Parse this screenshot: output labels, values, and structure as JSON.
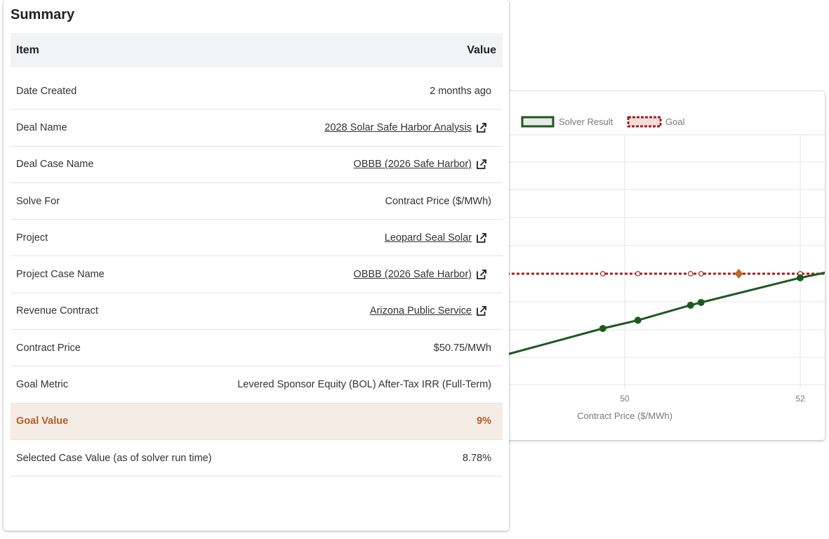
{
  "summary": {
    "title": "Summary",
    "header": {
      "item": "Item",
      "value": "Value"
    },
    "rows": [
      {
        "label": "Date Created",
        "value": "2 months ago",
        "link": false
      },
      {
        "label": "Deal Name",
        "value": "2028 Solar Safe Harbor Analysis",
        "link": true
      },
      {
        "label": "Deal Case Name",
        "value": "OBBB (2026 Safe Harbor)",
        "link": true
      },
      {
        "label": "Solve For",
        "value": "Contract Price ($/MWh)",
        "link": false
      },
      {
        "label": "Project",
        "value": "Leopard Seal Solar",
        "link": true
      },
      {
        "label": "Project Case Name",
        "value": "OBBB (2026 Safe Harbor)",
        "link": true
      },
      {
        "label": "Revenue Contract",
        "value": "Arizona Public Service",
        "link": true
      },
      {
        "label": "Contract Price",
        "value": "$50.75/MWh",
        "link": false
      },
      {
        "label": "Goal Metric",
        "value": "Levered Sponsor Equity (BOL) After-Tax IRR (Full-Term)",
        "link": false
      },
      {
        "label": "Goal Value",
        "value": "9%",
        "link": false,
        "highlight": true
      },
      {
        "label": "Selected Case Value (as of solver run time)",
        "value": "8.78%",
        "link": false
      }
    ],
    "icons": {
      "external_link": "external-link-icon"
    },
    "colors": {
      "highlight_bg": "#f5ece6",
      "highlight_text": "#b0602a"
    }
  },
  "chart_data": {
    "type": "line",
    "xlabel": "Contract Price ($/MWh)",
    "ylabel": "",
    "xlim": [
      48.6,
      52.3
    ],
    "x_ticks": [
      50,
      52
    ],
    "legend_position": "top",
    "series": [
      {
        "name": "Solver Result",
        "color": "#1b5a1e",
        "x": [
          48.6,
          49.75,
          50.15,
          50.75,
          50.87,
          52.0,
          52.3
        ],
        "y": [
          8.4,
          8.6,
          8.66,
          8.77,
          8.79,
          8.97,
          9.01
        ],
        "points_x": [
          49.75,
          50.15,
          50.75,
          50.87,
          52.0
        ]
      },
      {
        "name": "Goal",
        "color": "#a31f1f",
        "x": [
          48.6,
          49.75,
          50.15,
          50.75,
          50.87,
          52.0,
          52.3
        ],
        "y": [
          9,
          9,
          9,
          9,
          9,
          9,
          9
        ],
        "points_x": [
          49.75,
          50.15,
          50.75,
          50.87,
          52.0
        ]
      }
    ],
    "solution_point": {
      "x": 51.3,
      "y": 9,
      "color": "#c0692a"
    },
    "grid": true
  }
}
